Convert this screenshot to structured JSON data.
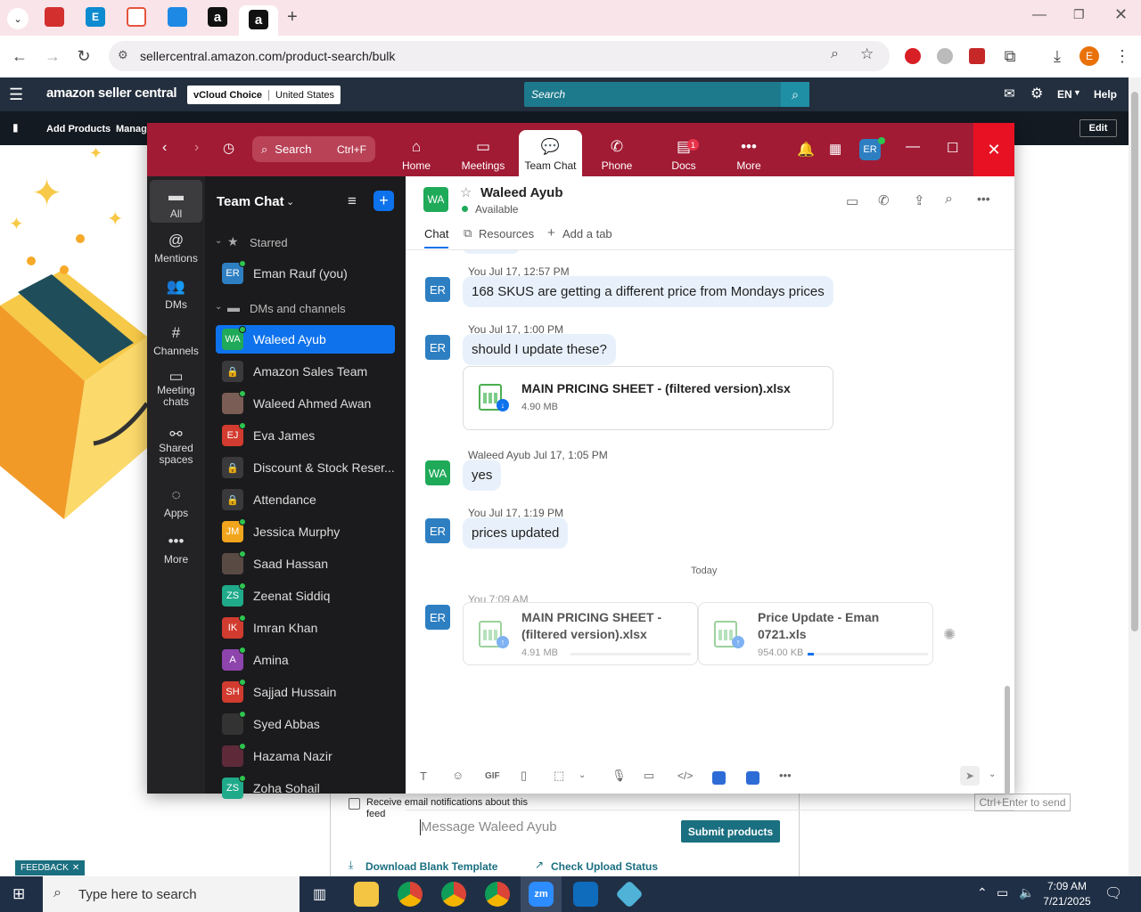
{
  "browser": {
    "url": "sellercentral.amazon.com/product-search/bulk",
    "profile_initial": "E"
  },
  "amazon": {
    "logo": "amazon seller central",
    "store_name": "vCloud Choice",
    "marketplace": "United States",
    "search_placeholder": "Search",
    "lang": "EN",
    "help": "Help",
    "nav": [
      "Add Products",
      "Manage"
    ],
    "edit": "Edit",
    "notify_label": "Receive email notifications about this feed",
    "submit": "Submit products",
    "download_template": "Download Blank Template",
    "check_status": "Check Upload Status",
    "feedback": "FEEDBACK"
  },
  "zoom": {
    "search": "Search",
    "search_shortcut": "Ctrl+F",
    "nav": [
      {
        "label": "Home",
        "icon": "home-icon",
        "badge": ""
      },
      {
        "label": "Meetings",
        "icon": "video-icon",
        "badge": ""
      },
      {
        "label": "Team Chat",
        "icon": "chat-icon",
        "badge": ""
      },
      {
        "label": "Phone",
        "icon": "phone-icon",
        "badge": ""
      },
      {
        "label": "Docs",
        "icon": "docs-icon",
        "badge": "1"
      },
      {
        "label": "More",
        "icon": "more-icon",
        "badge": ""
      }
    ],
    "user_initials": "ER",
    "rail": [
      {
        "label": "All",
        "icon": "chat-bubble-icon"
      },
      {
        "label": "Mentions",
        "icon": "at-icon"
      },
      {
        "label": "DMs",
        "icon": "people-icon"
      },
      {
        "label": "Channels",
        "icon": "hash-icon"
      },
      {
        "label": "Meeting chats",
        "icon": "calendar-icon"
      },
      {
        "label": "Shared spaces",
        "icon": "shared-icon"
      },
      {
        "label": "Apps",
        "icon": "apps-icon"
      },
      {
        "label": "More",
        "icon": "more-icon"
      }
    ],
    "sidebar_title": "Team Chat",
    "sections": {
      "starred": "Starred",
      "dms": "DMs and channels"
    },
    "starred": [
      {
        "initials": "ER",
        "name": "Eman Rauf (you)",
        "color": "#2e7fc2"
      }
    ],
    "contacts": [
      {
        "initials": "WA",
        "name": "Waleed Ayub",
        "color": "#1faa59",
        "selected": true
      },
      {
        "initials": "🔒",
        "name": "Amazon Sales Team",
        "color": "#3a3a3c"
      },
      {
        "initials": "",
        "name": "Waleed Ahmed Awan",
        "color": "#7a5d55"
      },
      {
        "initials": "EJ",
        "name": "Eva James",
        "color": "#d23b2f"
      },
      {
        "initials": "🔒",
        "name": "Discount & Stock Reser...",
        "color": "#3a3a3c"
      },
      {
        "initials": "🔒",
        "name": "Attendance",
        "color": "#3a3a3c"
      },
      {
        "initials": "JM",
        "name": "Jessica Murphy",
        "color": "#f1a51c"
      },
      {
        "initials": "",
        "name": "Saad Hassan",
        "color": "#5a4a44"
      },
      {
        "initials": "ZS",
        "name": "Zeenat Siddiq",
        "color": "#1faa8a"
      },
      {
        "initials": "IK",
        "name": "Imran Khan",
        "color": "#d23b2f"
      },
      {
        "initials": "A",
        "name": "Amina",
        "color": "#8e44ad"
      },
      {
        "initials": "SH",
        "name": "Sajjad Hussain",
        "color": "#d23b2f"
      },
      {
        "initials": "",
        "name": "Syed Abbas",
        "color": "#333"
      },
      {
        "initials": "",
        "name": "Hazama Nazir",
        "color": "#5e2a3a"
      },
      {
        "initials": "ZS",
        "name": "Zoha Sohail",
        "color": "#1faa8a"
      }
    ],
    "chat": {
      "contact_initials": "WA",
      "contact_name": "Waleed Ayub",
      "status": "Available",
      "tabs": [
        "Chat",
        "Resources",
        "Add a tab"
      ],
      "messages": [
        {
          "meta": "You Jul 17, 12:57 PM",
          "initials": "ER",
          "text": "168 SKUS are getting a different price from Mondays prices"
        },
        {
          "meta": "You Jul 17, 1:00 PM",
          "initials": "ER",
          "text": "should I update these?"
        },
        {
          "meta": "Waleed Ayub Jul 17, 1:05 PM",
          "initials": "WA",
          "text": "yes"
        },
        {
          "meta": "You Jul 17, 1:19 PM",
          "initials": "ER",
          "text": "prices updated"
        }
      ],
      "file1": {
        "name": "MAIN PRICING SHEET - (filtered version).xlsx",
        "size": "4.90 MB"
      },
      "divider": "Today",
      "upload_meta": "You 7:09 AM",
      "upload_files": [
        {
          "name": "MAIN PRICING SHEET - (filtered version).xlsx",
          "size": "4.91 MB",
          "progress": 0
        },
        {
          "name": "Price Update - Eman 0721.xls",
          "size": "954.00 KB",
          "progress": 0.05
        }
      ],
      "composer_placeholder": "Message Waleed Ayub",
      "send_hint": "Ctrl+Enter to send"
    }
  },
  "taskbar": {
    "search_placeholder": "Type here to search",
    "time": "7:09 AM",
    "date": "7/21/2025"
  }
}
